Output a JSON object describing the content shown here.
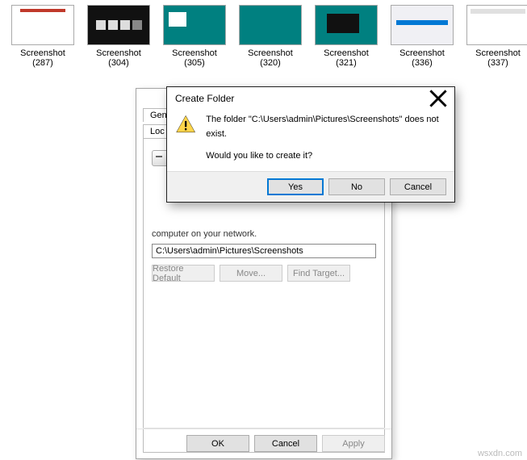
{
  "thumbs": [
    {
      "label": "Screenshot (287)",
      "cls": "t287"
    },
    {
      "label": "Screenshot (304)",
      "cls": "t304"
    },
    {
      "label": "Screenshot (305)",
      "cls": "t305"
    },
    {
      "label": "Screenshot (320)",
      "cls": "t320"
    },
    {
      "label": "Screenshot (321)",
      "cls": "t321"
    },
    {
      "label": "Screenshot (336)",
      "cls": "t336"
    },
    {
      "label": "Screenshot (337)",
      "cls": "t337"
    }
  ],
  "properties_window": {
    "tabs": {
      "front": "Gen",
      "back": "Loc"
    },
    "note": "computer on your network.",
    "path_value": "C:\\Users\\admin\\Pictures\\Screenshots",
    "restore_btn": "Restore Default",
    "move_btn": "Move...",
    "find_btn": "Find Target...",
    "ok_btn": "OK",
    "cancel_btn": "Cancel",
    "apply_btn": "Apply"
  },
  "dialog": {
    "title": "Create Folder",
    "line1": "The folder \"C:\\Users\\admin\\Pictures\\Screenshots\" does not exist.",
    "line2": "Would you like to create it?",
    "yes": "Yes",
    "no": "No",
    "cancel": "Cancel"
  },
  "watermark": "wsxdn.com"
}
